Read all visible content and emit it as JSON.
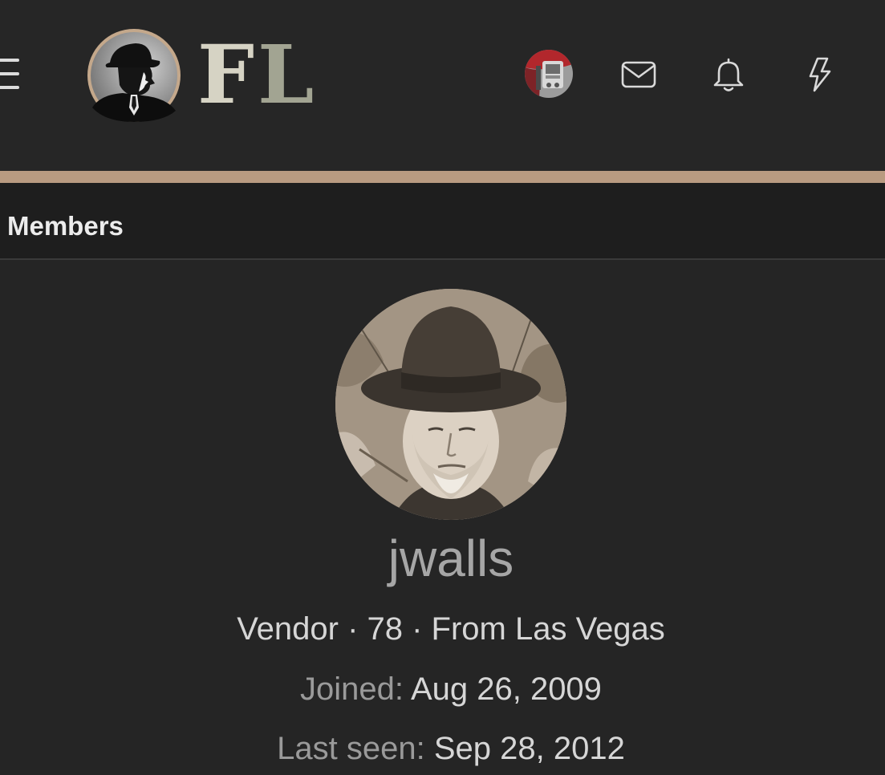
{
  "header": {
    "menu_icon": "hamburger-menu-icon",
    "logo": {
      "emblem": "detective-silhouette-emblem",
      "letter_1": "F",
      "letter_2": "L"
    },
    "icons": [
      "user-avatar",
      "mail-icon",
      "bell-icon",
      "bolt-icon"
    ],
    "colors": {
      "background": "#262626",
      "accent_bar": "#b99b81",
      "icon": "#d9d9d9"
    }
  },
  "breadcrumb": {
    "label": "Members"
  },
  "profile": {
    "username": "jwalls",
    "meta": "Vendor · 78 · From Las Vegas",
    "joined_label": "Joined:",
    "joined_value": "Aug 26, 2009",
    "last_seen_label": "Last seen:",
    "last_seen_value": "Sep 28, 2012"
  }
}
